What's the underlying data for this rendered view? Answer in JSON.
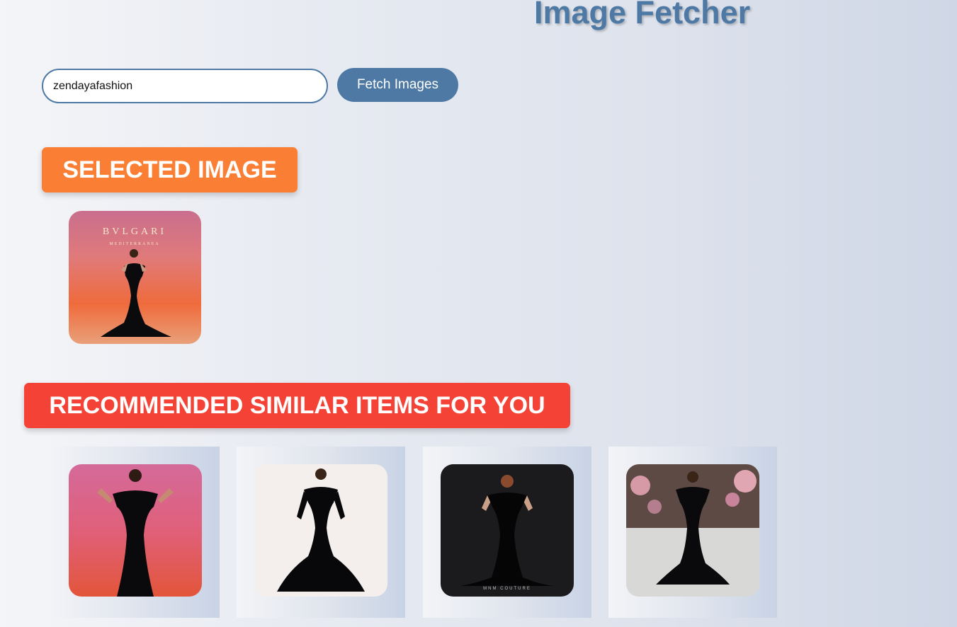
{
  "header": {
    "title": "Image Fetcher"
  },
  "search": {
    "value": "zendayafashion",
    "button_label": "Fetch Images"
  },
  "selected": {
    "heading": "SELECTED IMAGE",
    "image": {
      "brand_text": "BVLGARI",
      "sub_text": "MEDITERRANEA"
    }
  },
  "recommended": {
    "heading": "RECOMMENDED SIMILAR ITEMS FOR YOU",
    "items": [
      {
        "caption": ""
      },
      {
        "caption": ""
      },
      {
        "caption": "MNM COUTURE"
      },
      {
        "caption": ""
      }
    ]
  },
  "colors": {
    "accent": "#4d79a4",
    "selected_banner": "#fa7f35",
    "recommended_banner": "#f44336"
  }
}
